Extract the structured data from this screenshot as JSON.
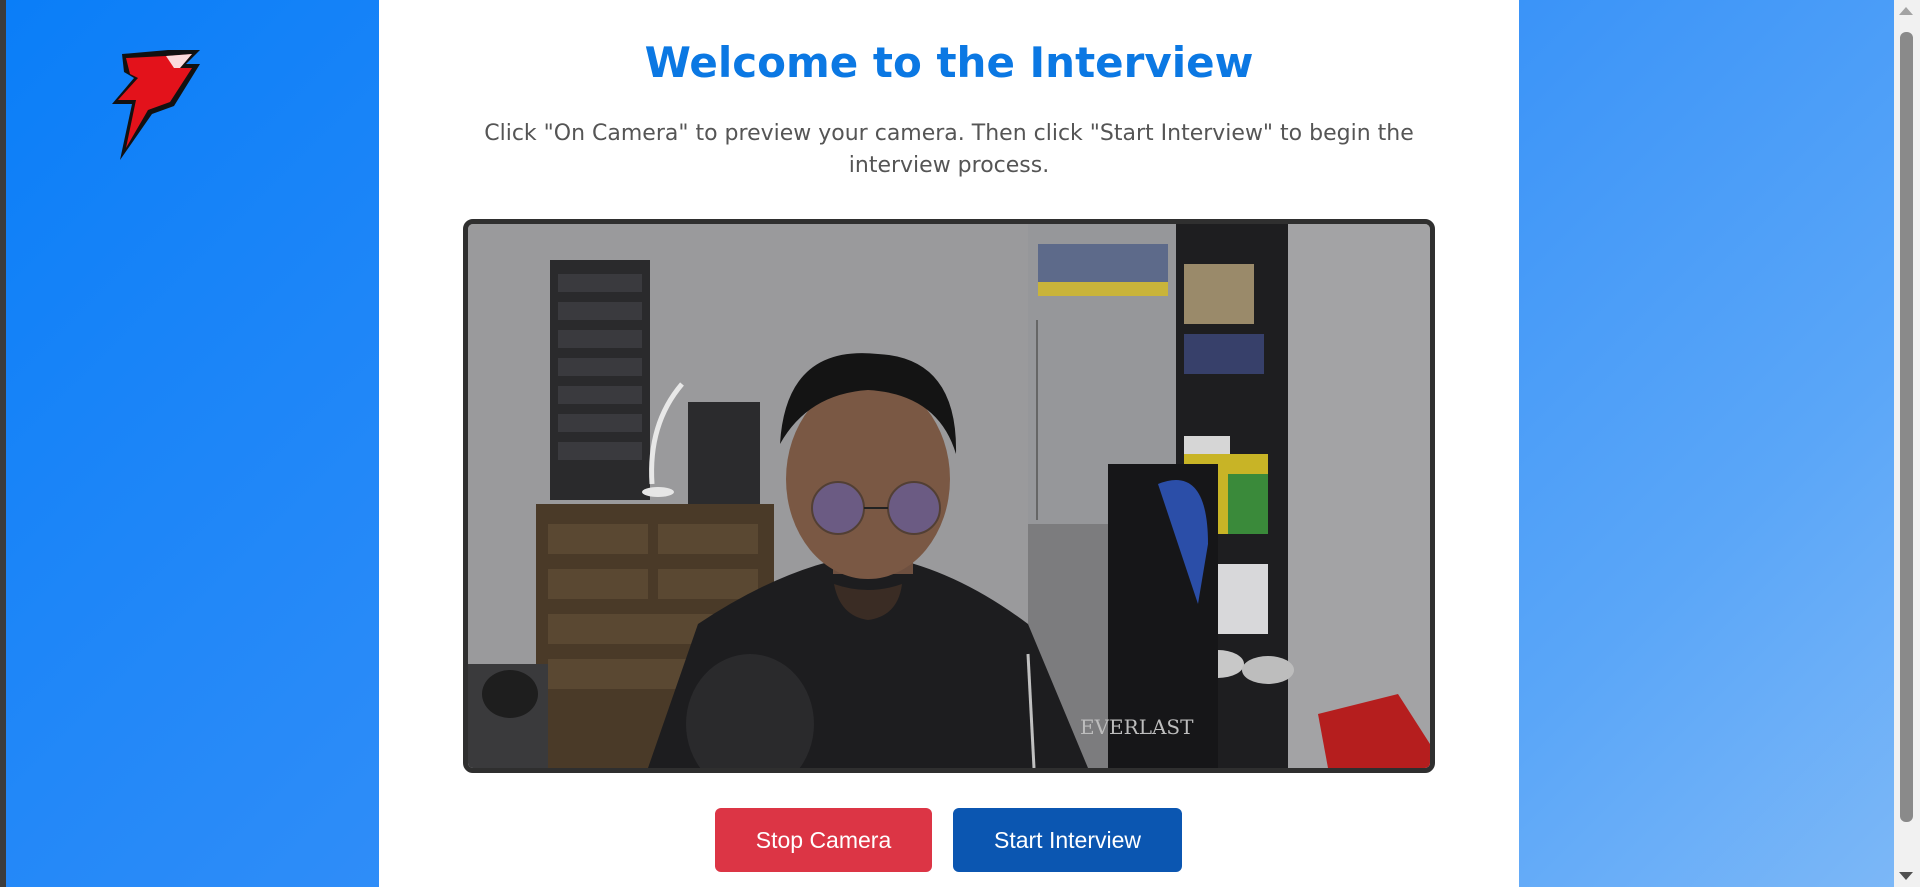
{
  "page": {
    "title": "Welcome to the Interview",
    "instructions": "Click \"On Camera\" to preview your camera. Then click \"Start Interview\" to begin the interview process."
  },
  "buttons": {
    "stop_camera": "Stop Camera",
    "start_interview": "Start Interview"
  },
  "camera": {
    "logo_text": "EVERLAST"
  },
  "colors": {
    "title": "#0b78e3",
    "stop_button": "#dc3545",
    "start_button": "#0b56b1",
    "background_start": "#0a7ef8",
    "background_end": "#7db8f7"
  }
}
